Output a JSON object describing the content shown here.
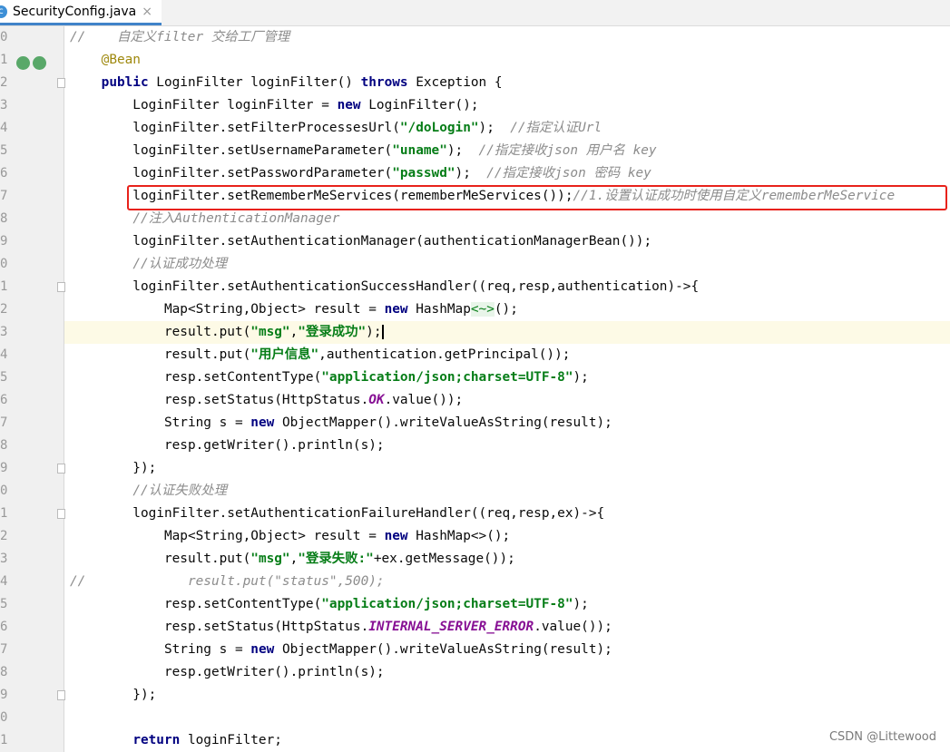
{
  "tab": {
    "title": "SecurityConfig.java",
    "icon": "java-class-icon",
    "close": "×"
  },
  "line_numbers": [
    "0",
    "1",
    "2",
    "3",
    "4",
    "5",
    "6",
    "7",
    "8",
    "9",
    "0",
    "1",
    "2",
    "3",
    "4",
    "5",
    "6",
    "7",
    "8",
    "9",
    "0",
    "1",
    "2",
    "3",
    "4",
    "5",
    "6",
    "7",
    "8",
    "9",
    "0",
    "1"
  ],
  "current_line": 13,
  "highlighted_line": 7,
  "highlight_color": "#e8221b",
  "lines": [
    [
      [
        "c",
        "//    自定义filter 交给工厂管理"
      ]
    ],
    [
      [
        "p",
        "    "
      ],
      [
        "a",
        "@Bean"
      ]
    ],
    [
      [
        "p",
        "    "
      ],
      [
        "k",
        "public"
      ],
      [
        "p",
        " LoginFilter loginFilter() "
      ],
      [
        "k",
        "throws"
      ],
      [
        "p",
        " Exception {"
      ]
    ],
    [
      [
        "p",
        "        LoginFilter loginFilter = "
      ],
      [
        "k",
        "new"
      ],
      [
        "p",
        " LoginFilter();"
      ]
    ],
    [
      [
        "p",
        "        loginFilter.setFilterProcessesUrl("
      ],
      [
        "s",
        "\"/doLogin\""
      ],
      [
        "p",
        ");  "
      ],
      [
        "c",
        "//指定认证Url"
      ]
    ],
    [
      [
        "p",
        "        loginFilter.setUsernameParameter("
      ],
      [
        "s",
        "\"uname\""
      ],
      [
        "p",
        ");  "
      ],
      [
        "c",
        "//指定接收json 用户名 key"
      ]
    ],
    [
      [
        "p",
        "        loginFilter.setPasswordParameter("
      ],
      [
        "s",
        "\"passwd\""
      ],
      [
        "p",
        ");  "
      ],
      [
        "c",
        "//指定接收json 密码 key"
      ]
    ],
    [
      [
        "p",
        "        loginFilter.setRememberMeServices(rememberMeServices());"
      ],
      [
        "c",
        "//1.设置认证成功时使用自定义rememberMeService"
      ]
    ],
    [
      [
        "p",
        "        "
      ],
      [
        "c",
        "//注入AuthenticationManager"
      ]
    ],
    [
      [
        "p",
        "        loginFilter.setAuthenticationManager(authenticationManagerBean());"
      ]
    ],
    [
      [
        "p",
        "        "
      ],
      [
        "c",
        "//认证成功处理"
      ]
    ],
    [
      [
        "p",
        "        loginFilter.setAuthenticationSuccessHandler((req,resp,authentication)->{"
      ]
    ],
    [
      [
        "p",
        "            Map<String,Object> result = "
      ],
      [
        "k",
        "new"
      ],
      [
        "p",
        " HashMap"
      ],
      [
        "g",
        "<~>"
      ],
      [
        "p",
        "();"
      ]
    ],
    [
      [
        "p",
        "            result.put("
      ],
      [
        "s",
        "\"msg\""
      ],
      [
        "p",
        ","
      ],
      [
        "s",
        "\"登录成功\""
      ],
      [
        "p",
        ");"
      ]
    ],
    [
      [
        "p",
        "            result.put("
      ],
      [
        "s",
        "\"用户信息\""
      ],
      [
        "p",
        ",authentication.getPrincipal());"
      ]
    ],
    [
      [
        "p",
        "            resp.setContentType("
      ],
      [
        "s",
        "\"application/json;charset=UTF-8\""
      ],
      [
        "p",
        ");"
      ]
    ],
    [
      [
        "p",
        "            resp.setStatus(HttpStatus."
      ],
      [
        "i",
        "OK"
      ],
      [
        "p",
        ".value());"
      ]
    ],
    [
      [
        "p",
        "            String s = "
      ],
      [
        "k",
        "new"
      ],
      [
        "p",
        " ObjectMapper().writeValueAsString(result);"
      ]
    ],
    [
      [
        "p",
        "            resp.getWriter().println(s);"
      ]
    ],
    [
      [
        "p",
        "        });"
      ]
    ],
    [
      [
        "p",
        "        "
      ],
      [
        "c",
        "//认证失败处理"
      ]
    ],
    [
      [
        "p",
        "        loginFilter.setAuthenticationFailureHandler((req,resp,ex)->{"
      ]
    ],
    [
      [
        "p",
        "            Map<String,Object> result = "
      ],
      [
        "k",
        "new"
      ],
      [
        "p",
        " HashMap<>();"
      ]
    ],
    [
      [
        "p",
        "            result.put("
      ],
      [
        "s",
        "\"msg\""
      ],
      [
        "p",
        ","
      ],
      [
        "s",
        "\"登录失败:\""
      ],
      [
        "p",
        "+ex.getMessage());"
      ]
    ],
    [
      [
        "c",
        "//             result.put(\"status\",500);"
      ]
    ],
    [
      [
        "p",
        "            resp.setContentType("
      ],
      [
        "s",
        "\"application/json;charset=UTF-8\""
      ],
      [
        "p",
        ");"
      ]
    ],
    [
      [
        "p",
        "            resp.setStatus(HttpStatus."
      ],
      [
        "i",
        "INTERNAL_SERVER_ERROR"
      ],
      [
        "p",
        ".value());"
      ]
    ],
    [
      [
        "p",
        "            String s = "
      ],
      [
        "k",
        "new"
      ],
      [
        "p",
        " ObjectMapper().writeValueAsString(result);"
      ]
    ],
    [
      [
        "p",
        "            resp.getWriter().println(s);"
      ]
    ],
    [
      [
        "p",
        "        });"
      ]
    ],
    [
      [
        "p",
        ""
      ]
    ],
    [
      [
        "p",
        "        "
      ],
      [
        "k",
        "return"
      ],
      [
        "p",
        " loginFilter;"
      ]
    ]
  ],
  "watermark": "CSDN @Littewood"
}
